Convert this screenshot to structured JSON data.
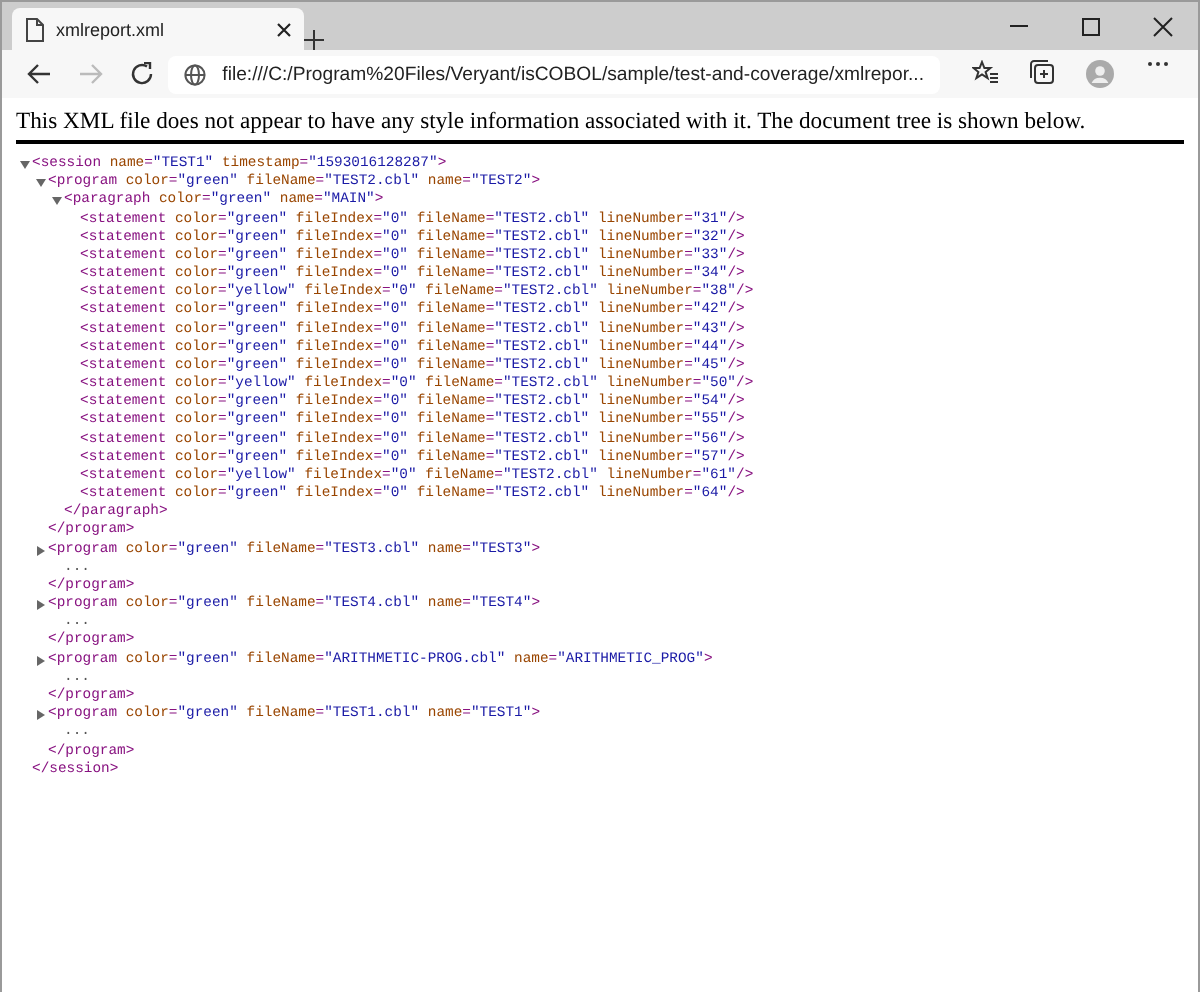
{
  "tab": {
    "title": "xmlreport.xml",
    "selected": true
  },
  "address": {
    "value": "file:///C:/Program%20Files/Veryant/isCOBOL/sample/test-and-coverage/xmlrepor..."
  },
  "navigation": {
    "back_disabled": false,
    "forward_disabled": true
  },
  "notice": "This XML file does not appear to have any style information associated with it. The document tree is shown below.",
  "tree": [
    {
      "open": "<session name=\"TEST1\" timestamp=\"1593016128287\">",
      "expanded": true,
      "close": "</session>",
      "children": [
        {
          "open": "<program color=\"green\" fileName=\"TEST2.cbl\" name=\"TEST2\">",
          "expanded": true,
          "close": "</program>",
          "children": [
            {
              "open": "<paragraph color=\"green\" name=\"MAIN\">",
              "expanded": true,
              "close": "</paragraph>",
              "children": [
                {
                  "line": "<statement color=\"green\" fileIndex=\"0\" fileName=\"TEST2.cbl\" lineNumber=\"31\"/>"
                },
                {
                  "line": "<statement color=\"green\" fileIndex=\"0\" fileName=\"TEST2.cbl\" lineNumber=\"32\"/>"
                },
                {
                  "line": "<statement color=\"green\" fileIndex=\"0\" fileName=\"TEST2.cbl\" lineNumber=\"33\"/>"
                },
                {
                  "line": "<statement color=\"green\" fileIndex=\"0\" fileName=\"TEST2.cbl\" lineNumber=\"34\"/>"
                },
                {
                  "line": "<statement color=\"yellow\" fileIndex=\"0\" fileName=\"TEST2.cbl\" lineNumber=\"38\"/>"
                },
                {
                  "line": "<statement color=\"green\" fileIndex=\"0\" fileName=\"TEST2.cbl\" lineNumber=\"42\"/>"
                },
                {
                  "line": "<statement color=\"green\" fileIndex=\"0\" fileName=\"TEST2.cbl\" lineNumber=\"43\"/>"
                },
                {
                  "line": "<statement color=\"green\" fileIndex=\"0\" fileName=\"TEST2.cbl\" lineNumber=\"44\"/>"
                },
                {
                  "line": "<statement color=\"green\" fileIndex=\"0\" fileName=\"TEST2.cbl\" lineNumber=\"45\"/>"
                },
                {
                  "line": "<statement color=\"yellow\" fileIndex=\"0\" fileName=\"TEST2.cbl\" lineNumber=\"50\"/>"
                },
                {
                  "line": "<statement color=\"green\" fileIndex=\"0\" fileName=\"TEST2.cbl\" lineNumber=\"54\"/>"
                },
                {
                  "line": "<statement color=\"green\" fileIndex=\"0\" fileName=\"TEST2.cbl\" lineNumber=\"55\"/>"
                },
                {
                  "line": "<statement color=\"green\" fileIndex=\"0\" fileName=\"TEST2.cbl\" lineNumber=\"56\"/>"
                },
                {
                  "line": "<statement color=\"green\" fileIndex=\"0\" fileName=\"TEST2.cbl\" lineNumber=\"57\"/>"
                },
                {
                  "line": "<statement color=\"yellow\" fileIndex=\"0\" fileName=\"TEST2.cbl\" lineNumber=\"61\"/>"
                },
                {
                  "line": "<statement color=\"green\" fileIndex=\"0\" fileName=\"TEST2.cbl\" lineNumber=\"64\"/>"
                }
              ]
            }
          ]
        },
        {
          "open": "<program color=\"green\" fileName=\"TEST3.cbl\" name=\"TEST3\">",
          "expanded": false,
          "ellipsis": "...",
          "close": "</program>"
        },
        {
          "open": "<program color=\"green\" fileName=\"TEST4.cbl\" name=\"TEST4\">",
          "expanded": false,
          "ellipsis": "...",
          "close": "</program>"
        },
        {
          "open": "<program color=\"green\" fileName=\"ARITHMETIC-PROG.cbl\" name=\"ARITHMETIC_PROG\">",
          "expanded": false,
          "ellipsis": "...",
          "close": "</program>"
        },
        {
          "open": "<program color=\"green\" fileName=\"TEST1.cbl\" name=\"TEST1\">",
          "expanded": false,
          "ellipsis": "...",
          "close": "</program>"
        }
      ]
    }
  ]
}
